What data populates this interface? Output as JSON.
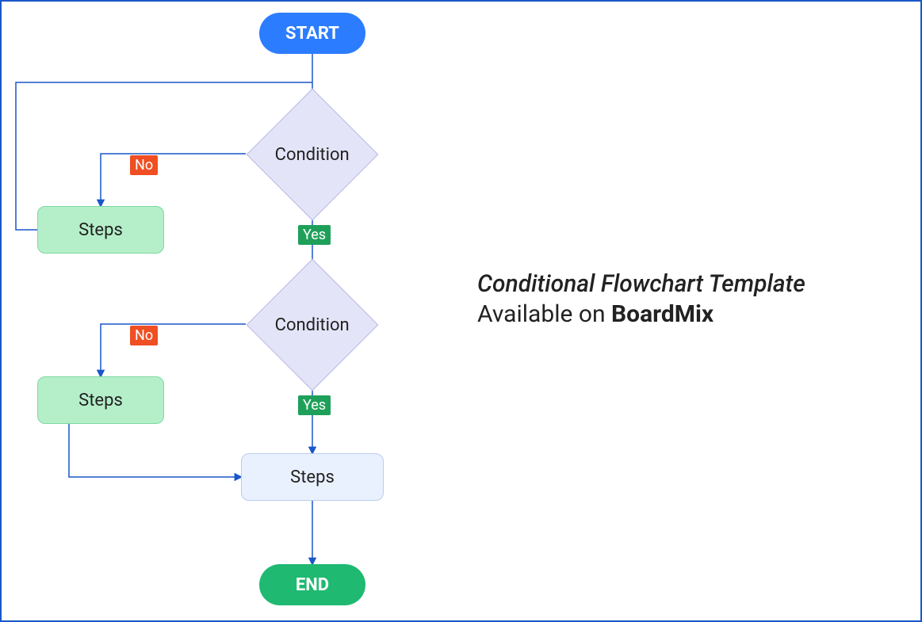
{
  "nodes": {
    "start": "START",
    "condition1": "Condition",
    "condition2": "Condition",
    "steps1": "Steps",
    "steps2": "Steps",
    "steps3": "Steps",
    "end": "END"
  },
  "labels": {
    "no": "No",
    "yes": "Yes"
  },
  "caption": {
    "title": "Conditional Flowchart Template",
    "line2_prefix": "Available on ",
    "brand": "BoardMix"
  },
  "colors": {
    "border": "#1a57c7",
    "arrow": "#1a57c7",
    "start": "#2b7cff",
    "end": "#1fb971",
    "diamond_fill": "#e4e4f8",
    "diamond_border": "#b8b8e6",
    "no_tag": "#f04e23",
    "yes_tag": "#1fa05a",
    "steps_green": "#b5efc9",
    "steps_blue": "#e9f1fe"
  }
}
